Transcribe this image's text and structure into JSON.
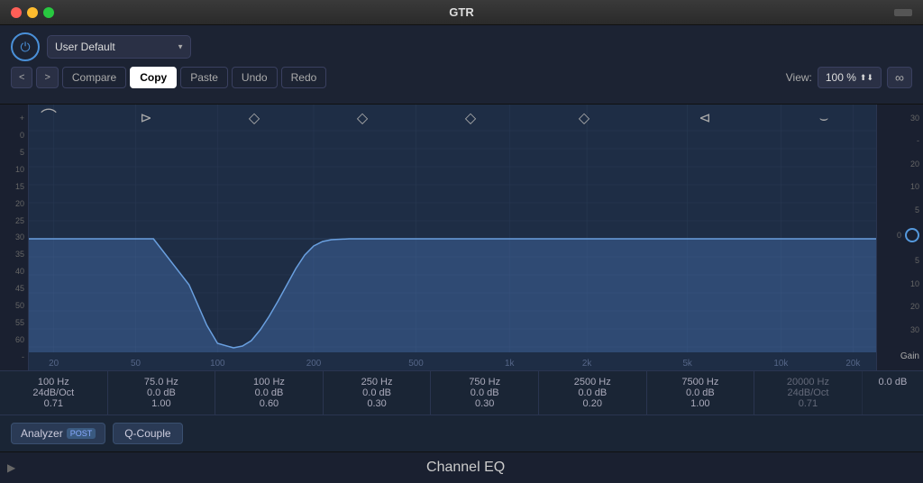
{
  "titleBar": {
    "title": "GTR"
  },
  "toolbar": {
    "presetValue": "User Default",
    "compareBtnLabel": "Compare",
    "copyBtnLabel": "Copy",
    "pasteBtnLabel": "Paste",
    "undoBtnLabel": "Undo",
    "redoBtnLabel": "Redo",
    "viewLabel": "View:",
    "viewPct": "100 %",
    "backBtnLabel": "<",
    "forwardBtnLabel": ">"
  },
  "bands": [
    {
      "icon": "⌒",
      "freq": "100 Hz",
      "gain": "24dB/Oct",
      "q": "0.71",
      "type": "highpass"
    },
    {
      "icon": "⊳",
      "freq": "75.0 Hz",
      "gain": "0.0 dB",
      "q": "1.00",
      "type": "lowshelf"
    },
    {
      "icon": "◇",
      "freq": "100 Hz",
      "gain": "0.0 dB",
      "q": "0.60",
      "type": "peak"
    },
    {
      "icon": "◇",
      "freq": "250 Hz",
      "gain": "0.0 dB",
      "q": "0.30",
      "type": "peak"
    },
    {
      "icon": "◇",
      "freq": "750 Hz",
      "gain": "0.0 dB",
      "q": "0.30",
      "type": "peak"
    },
    {
      "icon": "◇",
      "freq": "2500 Hz",
      "gain": "0.0 dB",
      "q": "0.20",
      "type": "peak"
    },
    {
      "icon": "⊲",
      "freq": "7500 Hz",
      "gain": "0.0 dB",
      "q": "1.00",
      "type": "highshelf"
    },
    {
      "icon": "⌣",
      "freq": "20000 Hz",
      "gain": "24dB/Oct",
      "q": "0.71",
      "type": "lowpass"
    }
  ],
  "freqLabels": [
    "20",
    "50",
    "100",
    "200",
    "500",
    "1k",
    "2k",
    "5k",
    "10k",
    "20k"
  ],
  "leftScale": [
    "+",
    "0",
    "5",
    "10",
    "15",
    "20",
    "25",
    "30",
    "35",
    "40",
    "45",
    "50",
    "55",
    "60",
    "-"
  ],
  "rightScale": [
    "30",
    "20",
    "10",
    "5",
    "0",
    "5",
    "10",
    "20",
    "30"
  ],
  "gainLabel": "Gain",
  "gainValue": "0.0 dB",
  "analyzerBtn": "Analyzer",
  "postLabel": "POST",
  "qCoupleBtn": "Q-Couple",
  "pluginName": "Channel EQ"
}
